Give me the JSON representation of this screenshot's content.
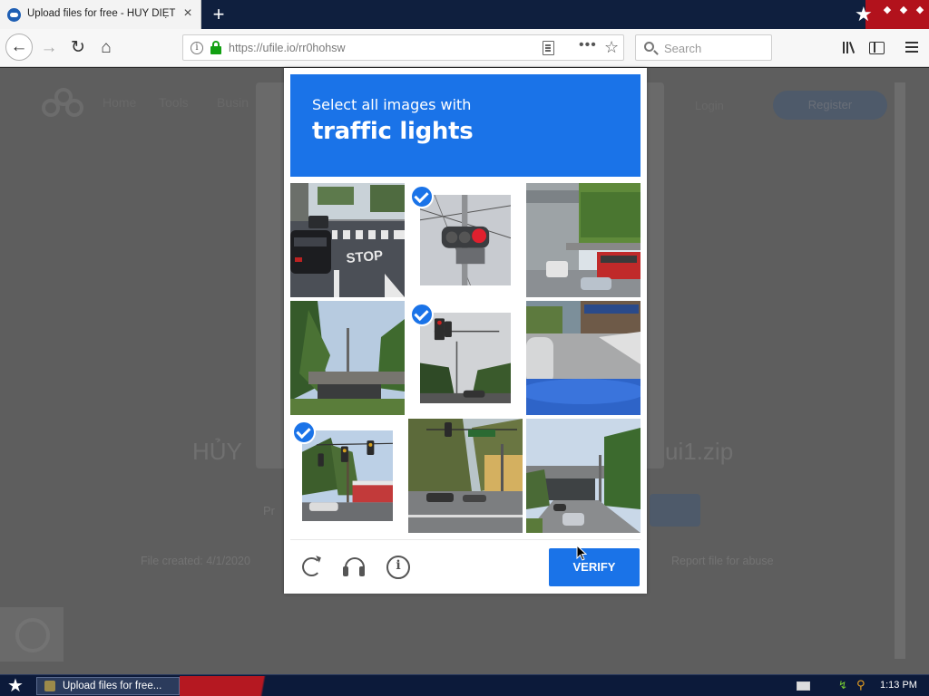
{
  "browser": {
    "tab_title": "Upload files for free - HỦY DIỆT M",
    "url": "https://ufile.io/rr0hohsw",
    "search_placeholder": "Search"
  },
  "page_bg": {
    "nav": [
      "Home",
      "Tools",
      "Busin"
    ],
    "login": "Login",
    "register": "Register",
    "heading_left": "HỦY",
    "heading_right": "ui1.zip",
    "footer_left": "File created: 4/1/2020",
    "footer_right": "Report file for abuse",
    "button_left": "Pr"
  },
  "captcha": {
    "prompt": "Select all images with",
    "target": "traffic lights",
    "verify_label": "VERIFY",
    "tiles": [
      {
        "scene": "street-stop",
        "selected": false
      },
      {
        "scene": "traffic-light-red",
        "selected": true
      },
      {
        "scene": "overpass-bus",
        "selected": false
      },
      {
        "scene": "trees-bridge",
        "selected": false
      },
      {
        "scene": "traffic-light-small",
        "selected": true
      },
      {
        "scene": "sidewalk-car",
        "selected": false
      },
      {
        "scene": "traffic-lights-street",
        "selected": true
      },
      {
        "scene": "intersection-signs",
        "selected": false
      },
      {
        "scene": "bridge-road",
        "selected": false
      }
    ]
  },
  "taskbar": {
    "item_label": "Upload files for free...",
    "clock": "1:13 PM"
  },
  "icons": {
    "favicon": "ufile-favicon-icon",
    "lock": "lock-icon",
    "refresh": "refresh-icon",
    "audio": "headphones-icon",
    "info": "info-icon"
  },
  "colors": {
    "captcha_blue": "#1a73e8",
    "titlebar": "#0f1f3e",
    "titlebar_red": "#b2121c"
  }
}
